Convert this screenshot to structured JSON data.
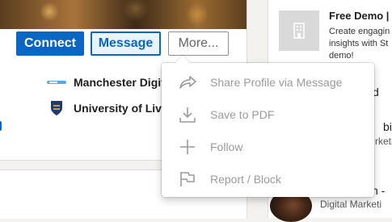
{
  "profile": {
    "connect_label": "Connect",
    "message_label": "Message",
    "more_label": "More...",
    "education": [
      {
        "name": "Manchester Digit"
      },
      {
        "name": "University of Live"
      }
    ]
  },
  "ad": {
    "title": "Free Demo |",
    "body": "Create engagin insights with St demo!",
    "fragments": [
      "d",
      "bir",
      "rketi",
      "h -",
      "Digital Marketi"
    ]
  },
  "menu": {
    "items": [
      {
        "label": "Share Profile via Message",
        "icon": "share-arrow-icon"
      },
      {
        "label": "Save to PDF",
        "icon": "download-icon"
      },
      {
        "label": "Follow",
        "icon": "plus-icon"
      },
      {
        "label": "Report / Block",
        "icon": "flag-icon"
      }
    ]
  },
  "colors": {
    "accent": "#0a66c2",
    "menu_text": "#9a9a9a",
    "page_bg": "#f3f2ef"
  }
}
